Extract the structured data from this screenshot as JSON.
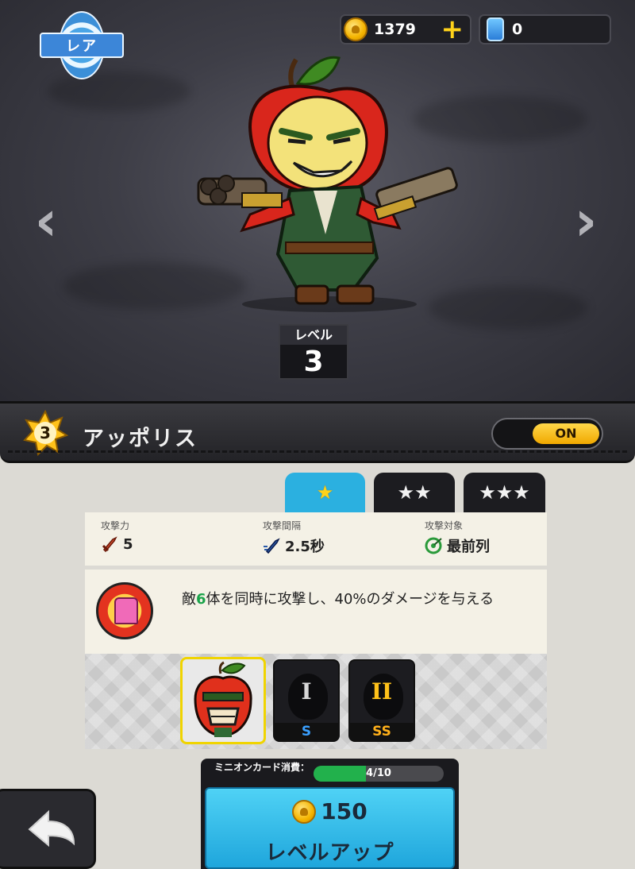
{
  "rarity": {
    "label": "レア"
  },
  "currency": {
    "gold": "1379",
    "gems": "0"
  },
  "hero": {
    "level_label": "レベル",
    "level": "3",
    "stars": "3",
    "name": "アッポリス",
    "toggle": "ON"
  },
  "tabs": [
    {
      "stars": "★",
      "selected": true
    },
    {
      "stars": "★★",
      "selected": false
    },
    {
      "stars": "★★★",
      "selected": false
    }
  ],
  "stats": [
    {
      "label": "攻撃力",
      "value": "5",
      "icon": "sword-icon",
      "color": "#d04a2a"
    },
    {
      "label": "攻撃間隔",
      "value": "2.5秒",
      "icon": "speed-sword-icon",
      "color": "#2a5aa8"
    },
    {
      "label": "攻撃対象",
      "value": "最前列",
      "icon": "target-icon",
      "color": "#2a9a3a"
    }
  ],
  "skill": {
    "pre": "敵",
    "count": "6",
    "post": "体を同時に攻撃し、40%のダメージを与える",
    "icon": "fortress-skill-icon"
  },
  "evolutions": [
    {
      "rank": "",
      "roman": "",
      "unlocked": true
    },
    {
      "rank": "S",
      "roman": "I",
      "unlocked": false
    },
    {
      "rank": "SS",
      "roman": "II",
      "unlocked": false
    }
  ],
  "levelup": {
    "cost_label": "ミニオンカード消費：",
    "progress_text": "4/10",
    "progress": 0.4,
    "price": "150",
    "button_label": "レベルアップ"
  },
  "colors": {
    "accent": "#2bb0e0",
    "gold": "#f5b400",
    "progress": "#22b14c"
  }
}
